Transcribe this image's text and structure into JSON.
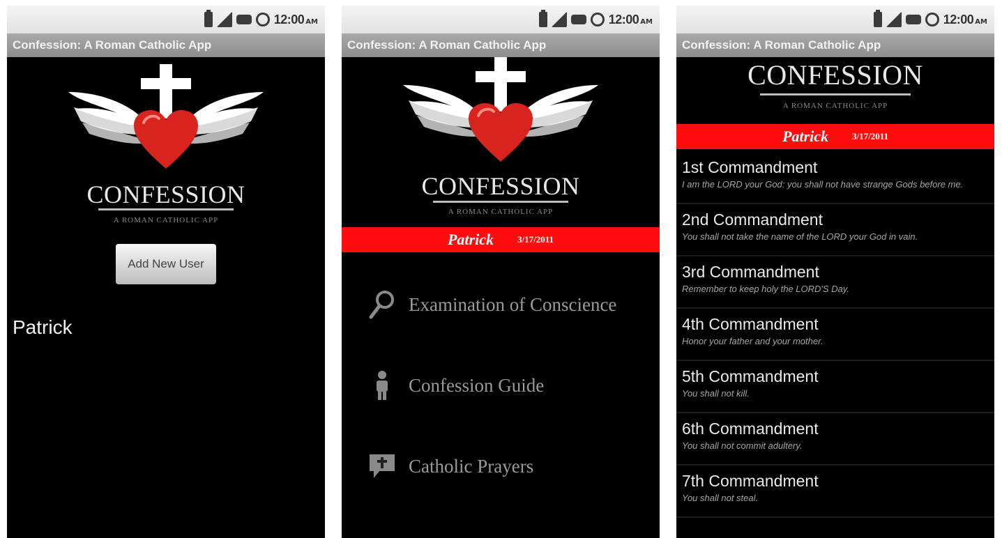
{
  "status_bar": {
    "time": "12:00",
    "ampm": "AM"
  },
  "app_title": "Confession: A Roman Catholic App",
  "brand": {
    "name": "CONFESSION",
    "tagline": "A ROMAN CATHOLIC APP"
  },
  "screen1": {
    "add_button": "Add New User",
    "users": [
      "Patrick"
    ]
  },
  "user": {
    "name": "Patrick",
    "date": "3/17/2011"
  },
  "screen2": {
    "menu": [
      {
        "label": "Examination of Conscience",
        "icon": "magnifier-icon"
      },
      {
        "label": "Confession Guide",
        "icon": "person-icon"
      },
      {
        "label": "Catholic Prayers",
        "icon": "prayer-bubble-icon"
      }
    ]
  },
  "screen3": {
    "commandments": [
      {
        "title": "1st Commandment",
        "text": "I am the LORD your God: you shall not have strange Gods before me."
      },
      {
        "title": "2nd Commandment",
        "text": "You shall not take the name of the LORD your God in vain."
      },
      {
        "title": "3rd Commandment",
        "text": "Remember to keep holy the LORD'S Day."
      },
      {
        "title": "4th Commandment",
        "text": "Honor your father and your mother."
      },
      {
        "title": "5th Commandment",
        "text": "You shall not kill."
      },
      {
        "title": "6th Commandment",
        "text": "You shall not commit adultery."
      },
      {
        "title": "7th Commandment",
        "text": "You shall not steal."
      }
    ]
  },
  "colors": {
    "accent_red": "#ff0d0d",
    "background": "#000000",
    "title_bar": "#9a9a9a"
  }
}
